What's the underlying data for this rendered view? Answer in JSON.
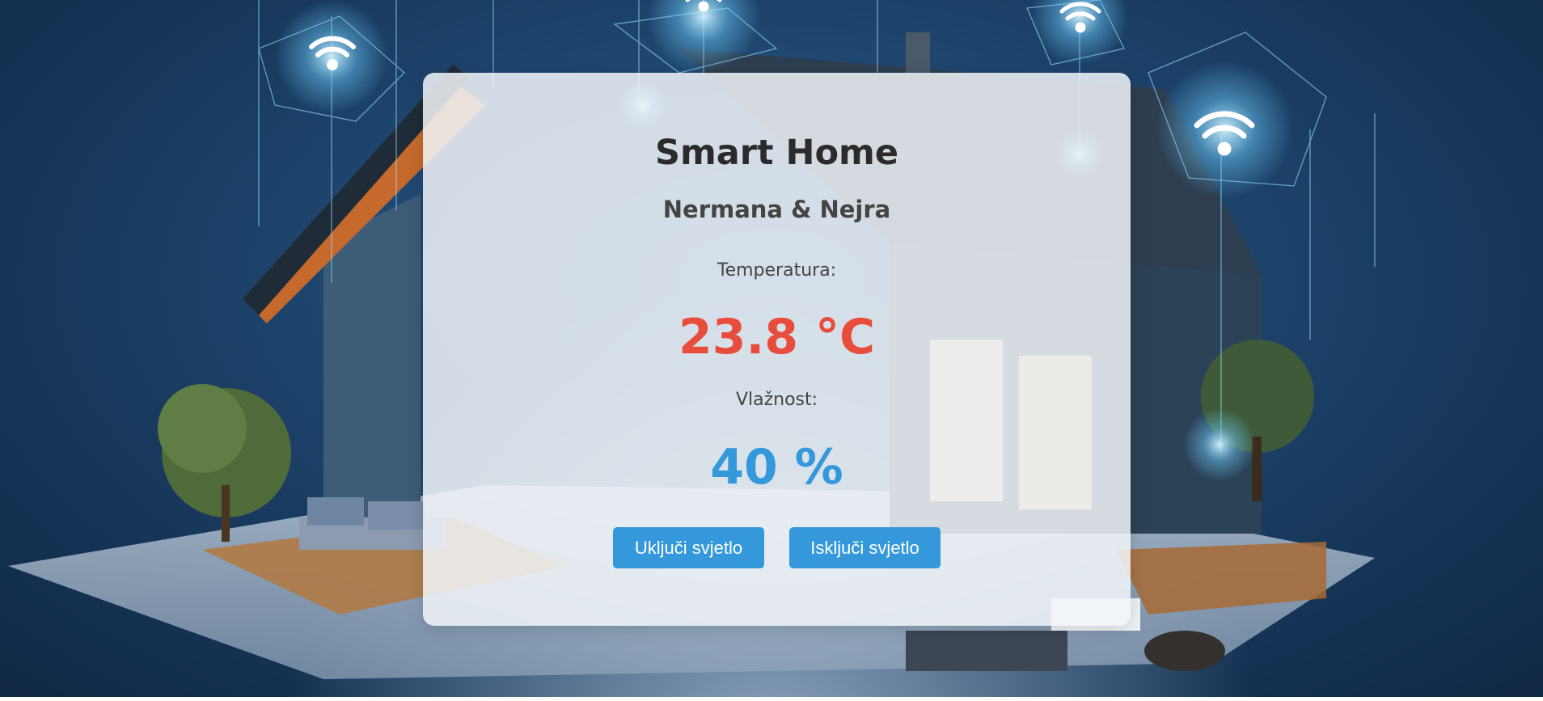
{
  "header": {
    "title": "Smart Home",
    "subtitle": "Nermana & Nejra"
  },
  "sensors": {
    "temperature_label": "Temperatura:",
    "temperature_value": "23.8 °C",
    "humidity_label": "Vlažnost:",
    "humidity_value": "40 %"
  },
  "controls": {
    "light_on_label": "Uključi svjetlo",
    "light_off_label": "Isključi svjetlo"
  },
  "colors": {
    "temperature": "#e74c3c",
    "humidity": "#3498db",
    "button": "#3498db"
  },
  "background": {
    "icons": [
      "wifi-icon",
      "wifi-icon",
      "wifi-icon",
      "wifi-icon"
    ]
  }
}
